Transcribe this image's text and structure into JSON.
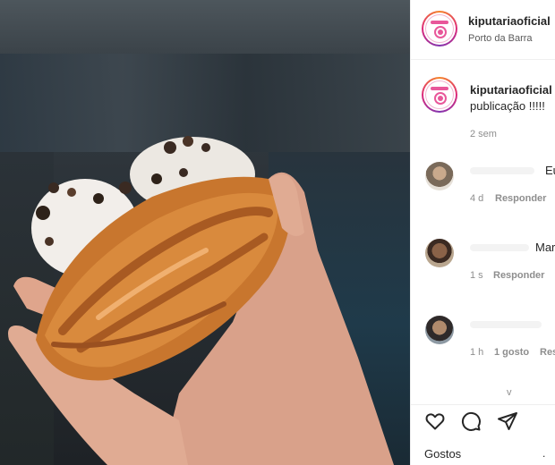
{
  "post": {
    "username": "kiputariaoficial",
    "location": "Porto da Barra"
  },
  "caption": {
    "username": "kiputariaoficial",
    "text": "publicação !!!!!",
    "time": "2 sem"
  },
  "comments": [
    {
      "text": "Eu",
      "time": "4 d",
      "likes": "",
      "reply": "Responder"
    },
    {
      "text": "Mar",
      "time": "1 s",
      "likes": "",
      "reply": "Responder"
    },
    {
      "text": "",
      "time": "1 h",
      "likes": "1 gosto",
      "reply": "Res"
    }
  ],
  "more_indicator": "v",
  "actions": {
    "like_icon": "heart-icon",
    "comment_icon": "comment-bubble-icon",
    "share_icon": "paper-plane-icon"
  },
  "likes_label": "Gostos",
  "likes_suffix": "."
}
